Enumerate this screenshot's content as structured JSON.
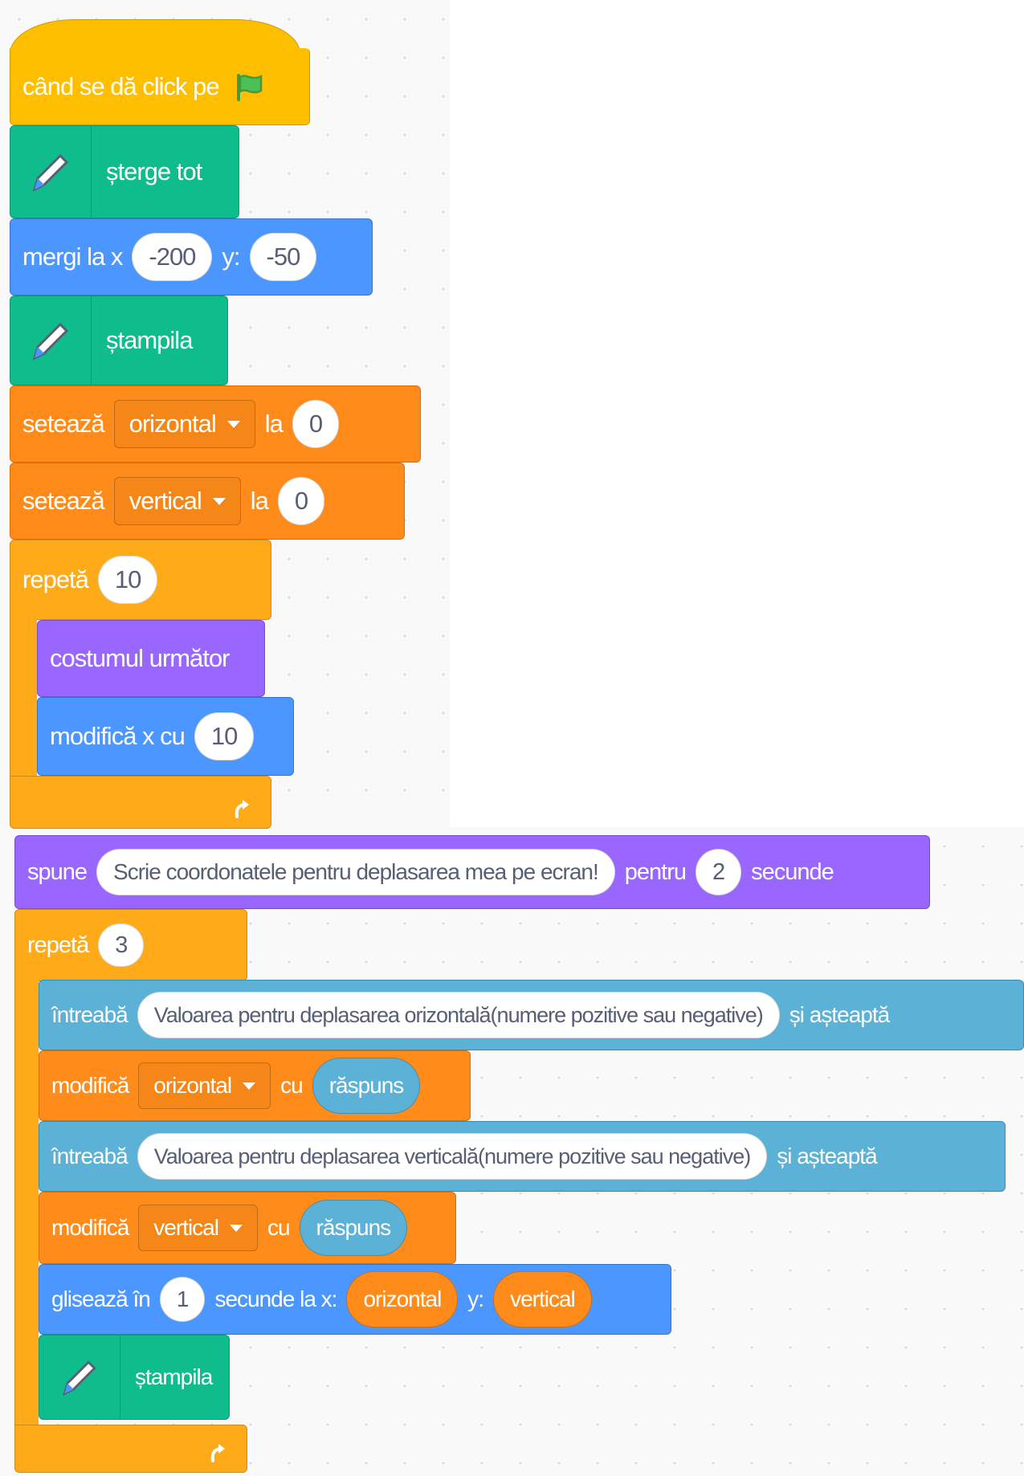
{
  "script1": {
    "hat_label": "când se dă click pe",
    "flag_icon": "green-flag-icon",
    "clear_label": "șterge tot",
    "goto": {
      "label": "mergi la x",
      "x": "-200",
      "y_label": "y:",
      "y": "-50"
    },
    "stamp_label": "ștampila",
    "set_h": {
      "label": "setează",
      "var": "orizontal",
      "to_label": "la",
      "value": "0"
    },
    "set_v": {
      "label": "setează",
      "var": "vertical",
      "to_label": "la",
      "value": "0"
    },
    "repeat": {
      "label": "repetă",
      "count": "10"
    },
    "next_costume_label": "costumul următor",
    "change_x": {
      "label": "modifică x cu",
      "value": "10"
    }
  },
  "script2": {
    "say": {
      "label": "spune",
      "message": "Scrie coordonatele pentru deplasarea mea pe ecran!",
      "for_label": "pentru",
      "secs": "2",
      "secs_label": "secunde"
    },
    "repeat": {
      "label": "repetă",
      "count": "3"
    },
    "ask_h": {
      "label": "întreabă",
      "question": "Valoarea pentru deplasarea orizontală(numere pozitive sau negative)",
      "wait_label": "și așteaptă"
    },
    "change_h": {
      "label": "modifică",
      "var": "orizontal",
      "by_label": "cu",
      "value": "răspuns"
    },
    "ask_v": {
      "label": "întreabă",
      "question": "Valoarea pentru deplasarea verticală(numere pozitive sau negative)",
      "wait_label": "și așteaptă"
    },
    "change_v": {
      "label": "modifică",
      "var": "vertical",
      "by_label": "cu",
      "value": "răspuns"
    },
    "glide": {
      "label": "glisează în",
      "secs": "1",
      "secs_label": "secunde la x:",
      "x": "orizontal",
      "y_label": "y:",
      "y": "vertical"
    },
    "stamp_label": "ștampila"
  },
  "colors": {
    "events": "#ffbf00",
    "pen": "#0fbd8c",
    "motion": "#4c97ff",
    "variables": "#ff8c1a",
    "control": "#ffab19",
    "looks": "#9966ff",
    "sensing": "#5cb1d6"
  }
}
